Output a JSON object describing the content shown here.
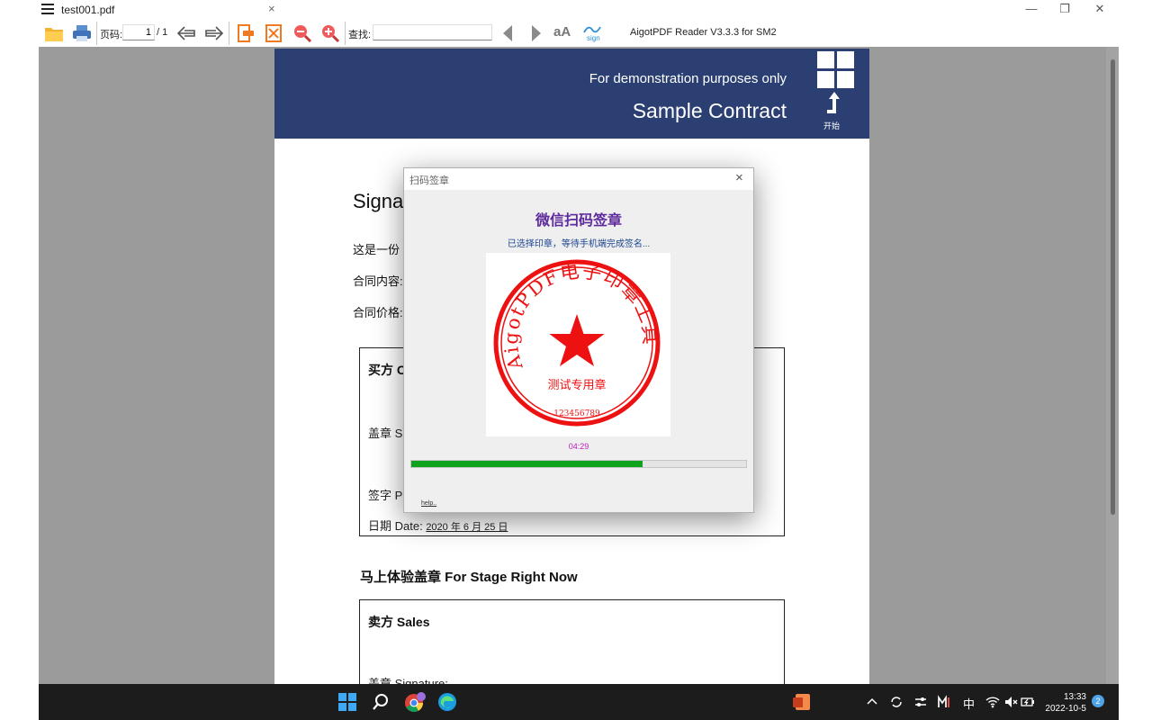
{
  "tab": {
    "title": "test001.pdf",
    "close": "×"
  },
  "window_controls": {
    "minimize": "—",
    "restore": "❐",
    "close": "✕"
  },
  "toolbar": {
    "page_label": "页码:",
    "page_current": "1",
    "page_total": "/ 1",
    "search_label": "查找:",
    "search_value": "",
    "font_size_label": "aA",
    "sign_label": "sign",
    "app_name": "AigotPDF Reader V3.3.3 for SM2",
    "icons": [
      "open-folder-icon",
      "print-icon",
      "previous-page-icon",
      "next-page-icon",
      "fit-width-icon",
      "fit-page-icon",
      "zoom-out-icon",
      "zoom-in-icon",
      "search-previous-icon",
      "search-next-icon",
      "font-size-icon",
      "sign-icon"
    ]
  },
  "document": {
    "banner_subtitle": "For demonstration purposes only",
    "banner_title": "Sample Contract",
    "logo_label": "开始",
    "heading": "Signa",
    "lines": [
      "这是一份",
      "合同内容:",
      "合同价格:"
    ],
    "buyer_box": {
      "title": "买方 C",
      "seal_line": "盖章 Si",
      "sign_line": "签字 Pr",
      "date_label": "日期 Date:",
      "date_value": "2020 年 6 月 25 日"
    },
    "section_heading": "马上体验盖章 For Stage Right Now",
    "seller_box": {
      "title": "卖方 Sales",
      "seal_line": "盖章 Signature:"
    }
  },
  "dialog": {
    "title": "扫码签章",
    "close": "×",
    "heading": "微信扫码签章",
    "status": "已选择印章，等待手机端完成签名...",
    "seal": {
      "arc_text": "AigotPDF电子印章工具",
      "center_text": "测试专用章",
      "serial": "123456789",
      "color": "#ee1111"
    },
    "timer": "04:29",
    "progress": 0.69,
    "help": "help.."
  },
  "taskbar": {
    "apps": [
      "windows-start-icon",
      "search-icon",
      "chrome-icon",
      "edge-icon",
      "powerpoint-icon"
    ],
    "tray_ime": "中",
    "time": "13:33",
    "date": "2022-10-5",
    "notification_count": "2"
  },
  "colors": {
    "banner": "#2b3f72",
    "dialog_heading": "#5e2b9c",
    "progress": "#0ea21d",
    "timer": "#c020c0"
  }
}
